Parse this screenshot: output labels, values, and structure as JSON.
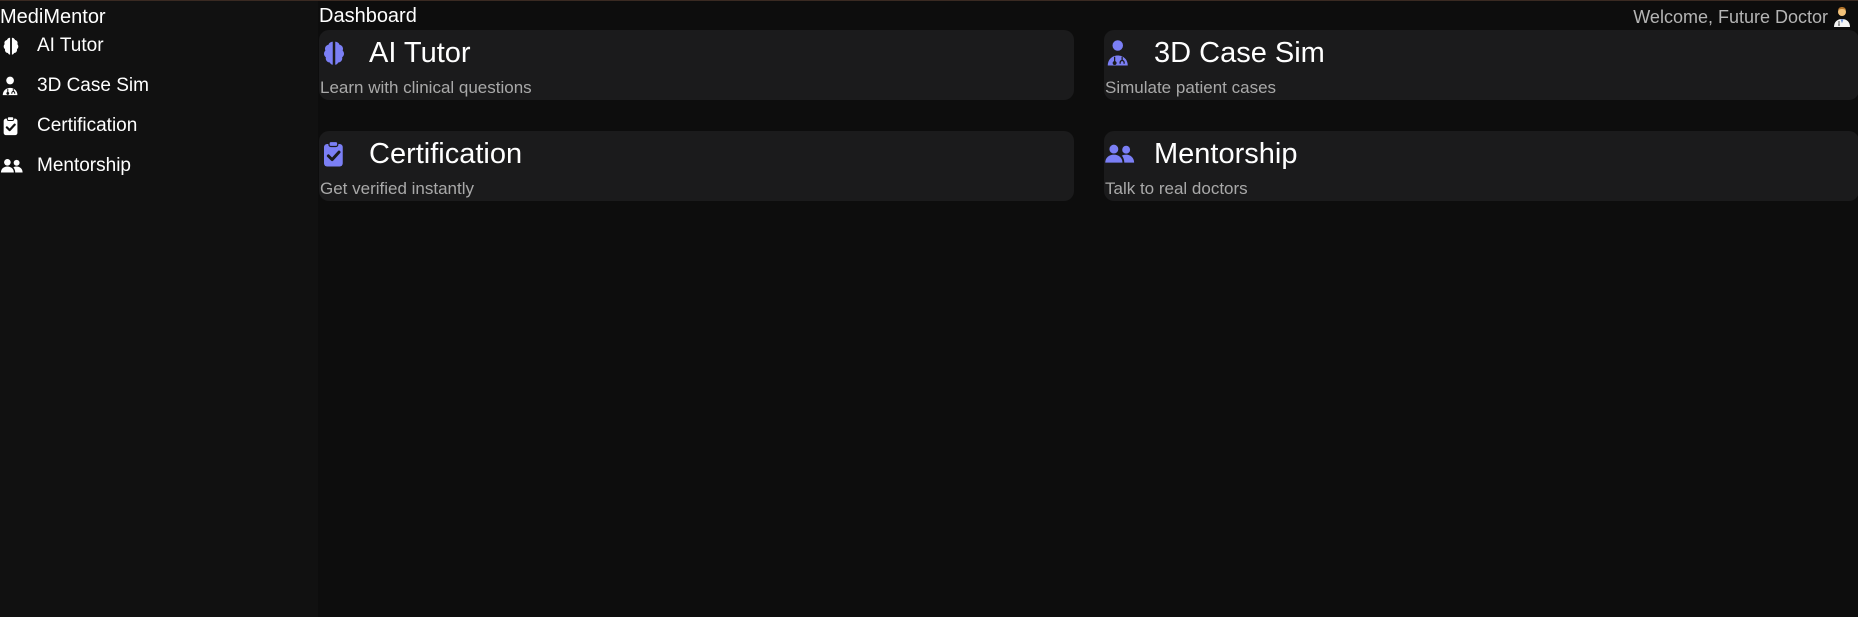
{
  "app": {
    "brand": "MediMentor",
    "accent_color": "#7b7ff5"
  },
  "sidebar": {
    "items": [
      {
        "label": "AI Tutor",
        "icon": "brain-icon"
      },
      {
        "label": "3D Case Sim",
        "icon": "user-doctor-icon"
      },
      {
        "label": "Certification",
        "icon": "clipboard-check-icon"
      },
      {
        "label": "Mentorship",
        "icon": "user-group-icon"
      }
    ]
  },
  "header": {
    "title": "Dashboard",
    "welcome": "Welcome, Future Doctor",
    "avatar_icon": "doctor-emoji-icon"
  },
  "cards": [
    {
      "title": "AI Tutor",
      "description": "Learn with clinical questions",
      "icon": "brain-icon"
    },
    {
      "title": "3D Case Sim",
      "description": "Simulate patient cases",
      "icon": "user-doctor-icon"
    },
    {
      "title": "Certification",
      "description": "Get verified instantly",
      "icon": "clipboard-check-icon"
    },
    {
      "title": "Mentorship",
      "description": "Talk to real doctors",
      "icon": "user-group-icon"
    }
  ]
}
